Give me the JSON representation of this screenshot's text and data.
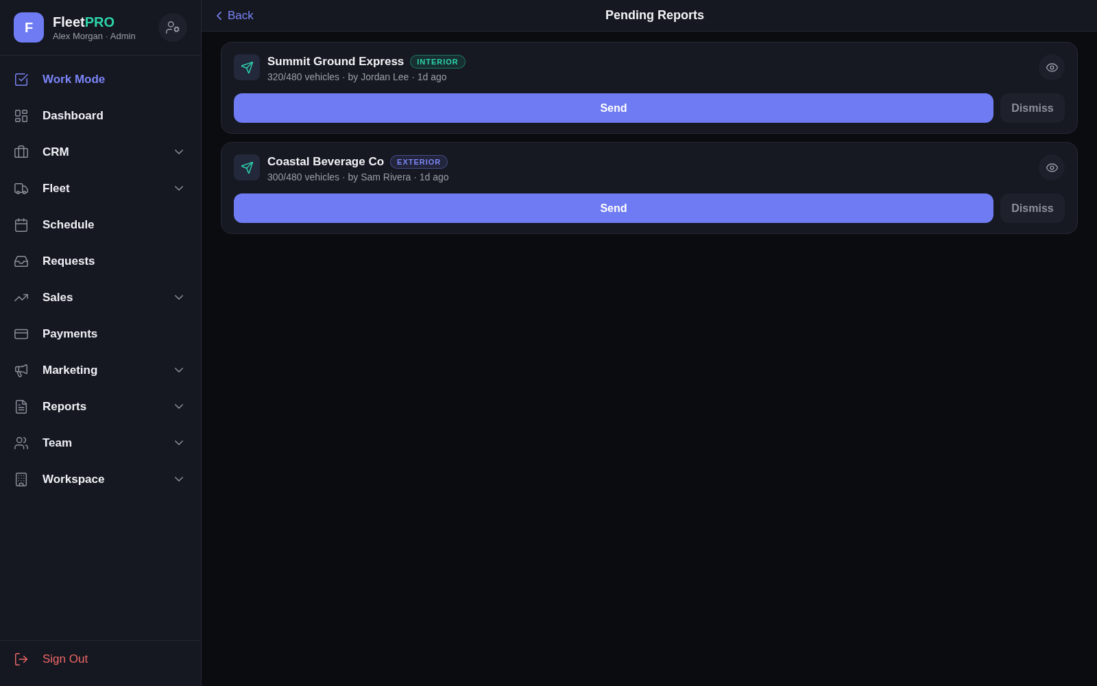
{
  "sidebar": {
    "logo_letter": "F",
    "brand": {
      "text": "Fleet",
      "accent": "PRO"
    },
    "user": "Alex Morgan · Admin",
    "items": [
      {
        "label": "Work Mode",
        "selected": true,
        "expandable": false
      },
      {
        "label": "Dashboard",
        "selected": false,
        "expandable": false
      },
      {
        "label": "CRM",
        "selected": false,
        "expandable": true
      },
      {
        "label": "Fleet",
        "selected": false,
        "expandable": true
      },
      {
        "label": "Schedule",
        "selected": false,
        "expandable": false
      },
      {
        "label": "Requests",
        "selected": false,
        "expandable": false
      },
      {
        "label": "Sales",
        "selected": false,
        "expandable": true
      },
      {
        "label": "Payments",
        "selected": false,
        "expandable": false
      },
      {
        "label": "Marketing",
        "selected": false,
        "expandable": true
      },
      {
        "label": "Reports",
        "selected": false,
        "expandable": true
      },
      {
        "label": "Team",
        "selected": false,
        "expandable": true
      },
      {
        "label": "Workspace",
        "selected": false,
        "expandable": true
      }
    ],
    "sign_out": "Sign Out"
  },
  "header": {
    "back": "Back",
    "title": "Pending Reports"
  },
  "reports": [
    {
      "name": "Summit Ground Express",
      "badge": {
        "label": "INTERIOR",
        "color": "#2dd4aa"
      },
      "details": "320/480 vehicles · by Jordan Lee · 1d ago",
      "send": "Send",
      "dismiss": "Dismiss"
    },
    {
      "name": "Coastal Beverage Co",
      "badge": {
        "label": "EXTERIOR",
        "color": "#7c86f5"
      },
      "details": "300/480 vehicles · by Sam Rivera · 1d ago",
      "send": "Send",
      "dismiss": "Dismiss"
    }
  ]
}
